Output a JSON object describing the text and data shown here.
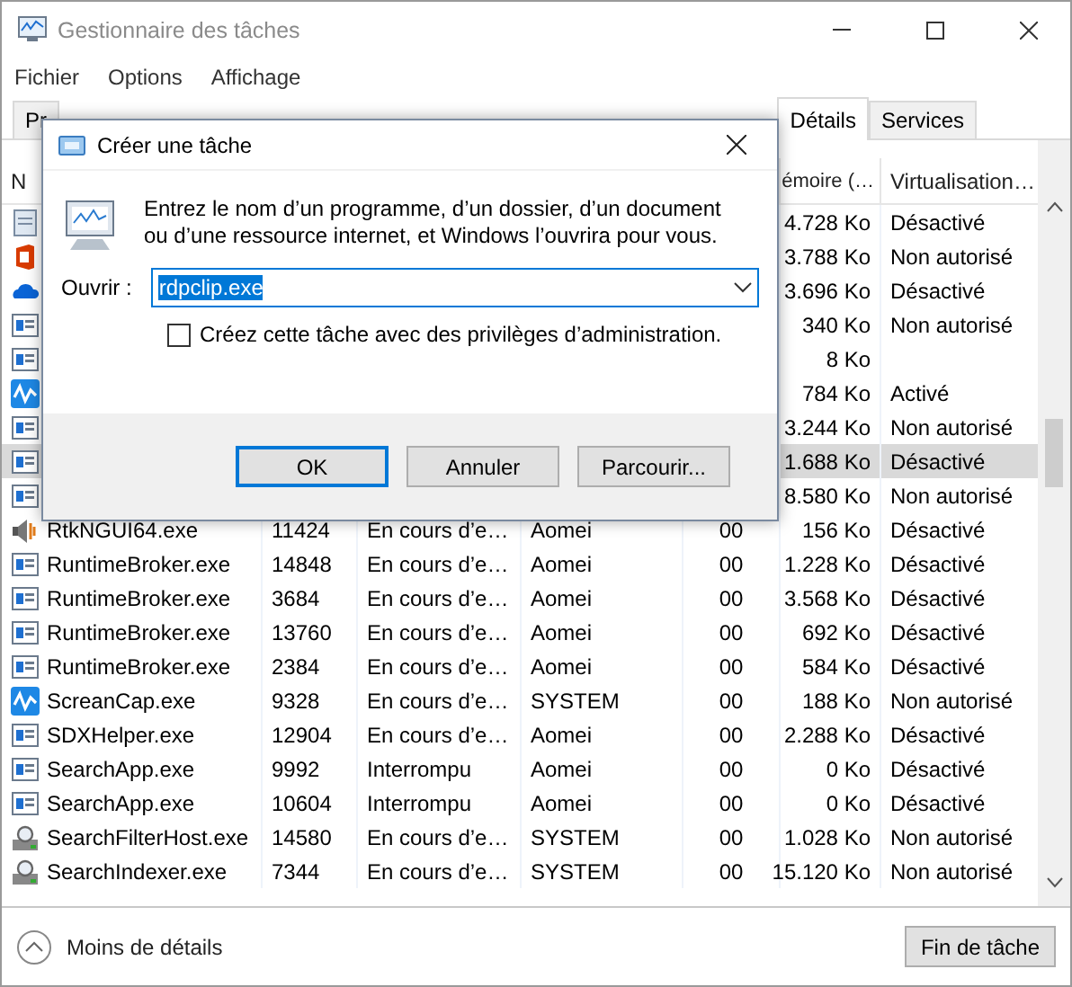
{
  "window": {
    "title": "Gestionnaire des tâches"
  },
  "menu": [
    "Fichier",
    "Options",
    "Affichage"
  ],
  "tabs": [
    {
      "label": "Pr",
      "selected": false
    },
    {
      "label": "Détails",
      "selected": true
    },
    {
      "label": "Services",
      "selected": false
    }
  ],
  "columns": [
    {
      "kind": "name",
      "label": "N"
    },
    {
      "kind": "memory",
      "label": "émoire (…"
    },
    {
      "kind": "virtualization",
      "label": "Virtualisation…"
    }
  ],
  "rows": [
    {
      "kind": "notepad",
      "memory": "4.728 Ko",
      "virtualization": "Désactivé",
      "selected": false
    },
    {
      "kind": "office",
      "memory": "3.788 Ko",
      "virtualization": "Non autorisé",
      "selected": false
    },
    {
      "kind": "cloud",
      "memory": "3.696 Ko",
      "virtualization": "Désactivé",
      "selected": false
    },
    {
      "kind": "window",
      "memory": "340 Ko",
      "virtualization": "Non autorisé",
      "selected": false
    },
    {
      "kind": "window",
      "memory": "8 Ko",
      "selected": false
    },
    {
      "kind": "pulse",
      "memory": "784 Ko",
      "virtualization": "Activé",
      "selected": false
    },
    {
      "kind": "window",
      "memory": "3.244 Ko",
      "virtualization": "Non autorisé",
      "selected": false
    },
    {
      "kind": "window",
      "memory": "1.688 Ko",
      "virtualization": "Désactivé",
      "selected": true
    },
    {
      "kind": "window",
      "memory": "8.580 Ko",
      "virtualization": "Non autorisé",
      "selected": false
    },
    {
      "kind": "speaker",
      "name": "RtkNGUI64.exe",
      "pid": "11424",
      "status": "En cours d’e…",
      "user": "Aomei",
      "cpu": "00",
      "memory": "156 Ko",
      "virtualization": "Désactivé",
      "selected": false
    },
    {
      "kind": "window",
      "name": "RuntimeBroker.exe",
      "pid": "14848",
      "status": "En cours d’e…",
      "user": "Aomei",
      "cpu": "00",
      "memory": "1.228 Ko",
      "virtualization": "Désactivé",
      "selected": false
    },
    {
      "kind": "window",
      "name": "RuntimeBroker.exe",
      "pid": "3684",
      "status": "En cours d’e…",
      "user": "Aomei",
      "cpu": "00",
      "memory": "3.568 Ko",
      "virtualization": "Désactivé",
      "selected": false
    },
    {
      "kind": "window",
      "name": "RuntimeBroker.exe",
      "pid": "13760",
      "status": "En cours d’e…",
      "user": "Aomei",
      "cpu": "00",
      "memory": "692 Ko",
      "virtualization": "Désactivé",
      "selected": false
    },
    {
      "kind": "window",
      "name": "RuntimeBroker.exe",
      "pid": "2384",
      "status": "En cours d’e…",
      "user": "Aomei",
      "cpu": "00",
      "memory": "584 Ko",
      "virtualization": "Désactivé",
      "selected": false
    },
    {
      "kind": "pulse",
      "name": "ScreanCap.exe",
      "pid": "9328",
      "status": "En cours d’e…",
      "user": "SYSTEM",
      "cpu": "00",
      "memory": "188 Ko",
      "virtualization": "Non autorisé",
      "selected": false
    },
    {
      "kind": "window",
      "name": "SDXHelper.exe",
      "pid": "12904",
      "status": "En cours d’e…",
      "user": "Aomei",
      "cpu": "00",
      "memory": "2.288 Ko",
      "virtualization": "Désactivé",
      "selected": false
    },
    {
      "kind": "window",
      "name": "SearchApp.exe",
      "pid": "9992",
      "status": "Interrompu",
      "user": "Aomei",
      "cpu": "00",
      "memory": "0 Ko",
      "virtualization": "Désactivé",
      "selected": false
    },
    {
      "kind": "window",
      "name": "SearchApp.exe",
      "pid": "10604",
      "status": "Interrompu",
      "user": "Aomei",
      "cpu": "00",
      "memory": "0 Ko",
      "virtualization": "Désactivé",
      "selected": false
    },
    {
      "kind": "search",
      "name": "SearchFilterHost.exe",
      "pid": "14580",
      "status": "En cours d’e…",
      "user": "SYSTEM",
      "cpu": "00",
      "memory": "1.028 Ko",
      "virtualization": "Non autorisé",
      "selected": false
    },
    {
      "kind": "search",
      "name": "SearchIndexer.exe",
      "pid": "7344",
      "status": "En cours d’e…",
      "user": "SYSTEM",
      "cpu": "00",
      "memory": "15.120 Ko",
      "virtualization": "Non autorisé",
      "selected": false
    }
  ],
  "footer": {
    "toggle": "Moins de détails",
    "end_task": "Fin de tâche"
  },
  "dialog": {
    "title": "Créer une tâche",
    "description": "Entrez le nom d’un programme, d’un dossier, d’un document ou d’une ressource internet, et Windows l’ouvrira pour vous.",
    "open_label": "Ouvrir :",
    "open_value": "rdpclip.exe",
    "admin_label": "Créez cette tâche avec des privilèges d’administration.",
    "admin_checked": false,
    "buttons": [
      {
        "label": "OK",
        "default": true
      },
      {
        "label": "Annuler",
        "default": false
      },
      {
        "label": "Parcourir...",
        "default": false
      }
    ]
  }
}
